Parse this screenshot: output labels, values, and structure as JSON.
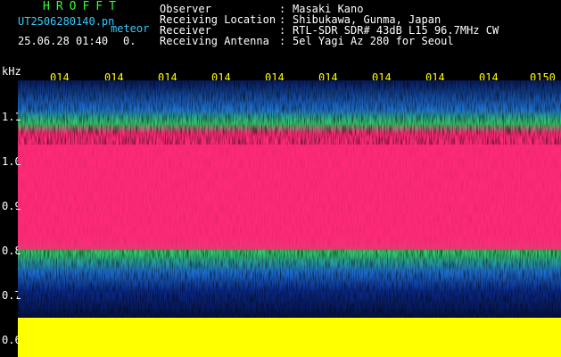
{
  "header": {
    "app_title": "HROFFT",
    "file_name": "UT2506280140.pn",
    "meteor_label": "meteor",
    "date_time": "25.06.28 01:40",
    "count": "0.",
    "fields": [
      {
        "label": "Observer",
        "value": "Masaki Kano"
      },
      {
        "label": "Receiving Location",
        "value": "Shibukawa, Gunma, Japan"
      },
      {
        "label": "Receiver",
        "value": "RTL-SDR SDR# 43dB L15 96.7MHz CW"
      },
      {
        "label": "Receiving Antenna",
        "value": "5el Yagi Az 280 for Seoul"
      }
    ],
    "separator": ":"
  },
  "spectrogram": {
    "y_unit": "kHz",
    "y_ticks": [
      "1.1",
      "1.0",
      "0.9",
      "0.8",
      "0.7",
      "0.6"
    ],
    "x_ticks": [
      "014",
      "014",
      "014",
      "014",
      "014",
      "014",
      "014",
      "014",
      "014",
      "0150"
    ],
    "colors": {
      "background": "#000000",
      "noise_low": "#0a2a8a",
      "noise_mid": "#1e6fd0",
      "noise_high": "#33cc66",
      "signal": "#ff2a78",
      "floor": "#ffff00"
    }
  }
}
